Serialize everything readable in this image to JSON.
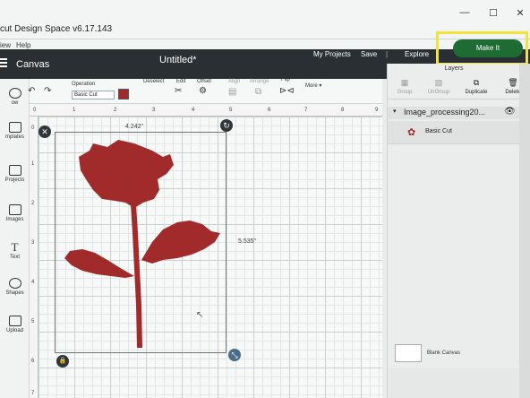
{
  "app": {
    "title": "cut Design Space  v6.17.143",
    "menu": [
      "iew",
      "Help"
    ]
  },
  "window_controls": {
    "minimize": "—",
    "maximize": "☐",
    "close": "✕"
  },
  "header": {
    "canvas_label": "Canvas",
    "doc_title": "Untitled*",
    "my_projects": "My Projects",
    "save": "Save",
    "separator": "|",
    "explore": "Explore",
    "make_it": "Make It"
  },
  "left_sidebar": {
    "items": [
      {
        "label": "ow",
        "icon": "new-icon"
      },
      {
        "label": "mplates",
        "icon": "templates-icon"
      },
      {
        "label": "Projects",
        "icon": "projects-icon"
      },
      {
        "label": "Images",
        "icon": "images-icon"
      },
      {
        "label": "Text",
        "icon": "text-icon"
      },
      {
        "label": "Shapes",
        "icon": "shapes-icon"
      },
      {
        "label": "Upload",
        "icon": "upload-icon"
      }
    ]
  },
  "toolbar": {
    "operation_label": "Operation",
    "operation_value": "Basic Cut",
    "operation_color": "#a12a2a",
    "deselect": "Deselect",
    "edit": "Edit",
    "offset": "Offset",
    "align": "Align",
    "arrange": "Arrange",
    "flip": "Flip",
    "more": "More ▾"
  },
  "rulers": {
    "top": [
      "0",
      "1",
      "2",
      "3",
      "4",
      "5",
      "6",
      "7",
      "8",
      "9"
    ],
    "left": [
      "0",
      "1",
      "2",
      "3",
      "4",
      "5",
      "6",
      "7"
    ]
  },
  "canvas": {
    "width_label": "4.242\"",
    "height_label": "5.535\"",
    "handle_close": "✕",
    "handle_rotate": "↻",
    "handle_lock": "🔒",
    "handle_resize": "⤡"
  },
  "layers": {
    "title": "Layers",
    "tools": [
      {
        "label": "Group",
        "enabled": false
      },
      {
        "label": "UnGroup",
        "enabled": false
      },
      {
        "label": "Duplicate",
        "enabled": true
      },
      {
        "label": "Delete",
        "enabled": true
      }
    ],
    "group_name": "Image_processing20...",
    "item_label": "Basic Cut",
    "blank_canvas": "Blank Canvas"
  },
  "colors": {
    "accent": "#1f6b34",
    "shape": "#a12a2a",
    "highlight": "#f2e23a",
    "header": "#2a2f33"
  }
}
